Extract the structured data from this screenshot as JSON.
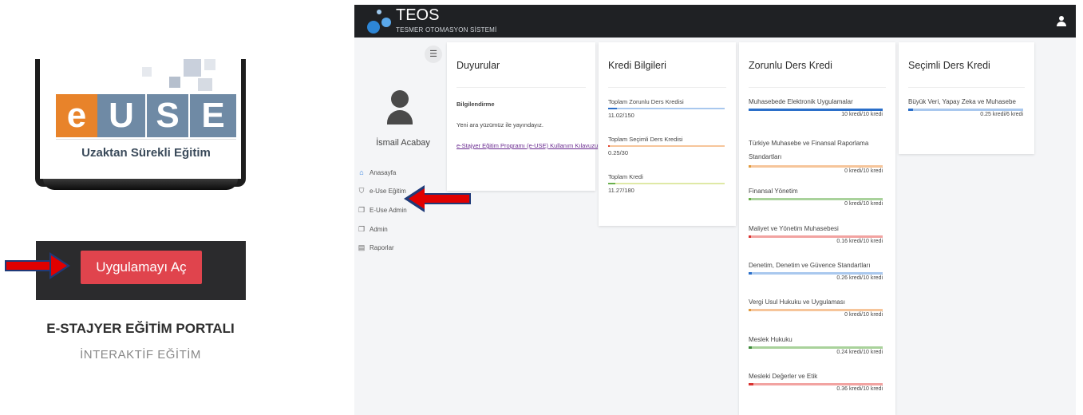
{
  "left_panel": {
    "logo_letters": [
      "e",
      "U",
      "S",
      "E"
    ],
    "logo_tagline": "Uzaktan Sürekli Eğitim",
    "open_app_button": "Uygulamayı Aç",
    "portal_title": "E-STAJYER EĞİTİM PORTALI",
    "portal_subtitle": "İNTERAKTİF EĞİTİM"
  },
  "app": {
    "brand_name": "TEOS",
    "brand_subtitle": "TESMER OTOMASYON SİSTEMİ",
    "sidebar_toggle_icon": "collapse-icon",
    "user_name": "İsmail Acabay",
    "nav": [
      {
        "label": "Anasayfa",
        "icon": "home-icon"
      },
      {
        "label": "e-Use Eğitim",
        "icon": "graduation-cap-icon"
      },
      {
        "label": "E-Use Admin",
        "icon": "copy-icon"
      },
      {
        "label": "Admin",
        "icon": "copy-icon"
      },
      {
        "label": "Raporlar",
        "icon": "file-icon"
      }
    ],
    "duyurular": {
      "title": "Duyurular",
      "heading": "Bilgilendirme",
      "text": "Yeni ara yüzümüz ile yayındayız.",
      "link": "e-Stajyer Eğitim Programı (e-USE) Kullanım Kılavuzu"
    },
    "kredi_bilgileri": {
      "title": "Kredi Bilgileri",
      "items": [
        {
          "label": "Toplam Zorunlu Ders Kredisi",
          "value": "11.02/150",
          "progress": 0.073,
          "color": "#2b6fc9",
          "track": "#a9c8ee"
        },
        {
          "label": "Toplam Seçimli Ders Kredisi",
          "value": "0.25/30",
          "progress": 0.008,
          "color": "#e0442e",
          "track": "#f6c59a"
        },
        {
          "label": "Toplam Kredi",
          "value": "11.27/180",
          "progress": 0.063,
          "color": "#6ab04c",
          "track": "#dfe9a6"
        }
      ]
    },
    "zorunlu": {
      "title": "Zorunlu Ders Kredi",
      "items": [
        {
          "label": "Muhasebede Elektronik Uygulamalar",
          "value": "10 kredi/10 kredi",
          "progress": 1.0,
          "color": "#2b6fc9",
          "track": "#a9c8ee"
        },
        {
          "label": "Türkiye Muhasebe ve Finansal Raporlama Standartları",
          "value": "0 kredi/10 kredi",
          "progress": 0.0,
          "color": "#e09a3e",
          "track": "#f6c59a"
        },
        {
          "label": "Finansal Yönetim",
          "value": "0 kredi/10 kredi",
          "progress": 0.0,
          "color": "#6ab04c",
          "track": "#a9d29b"
        },
        {
          "label": "Maliyet ve Yönetim Muhasebesi",
          "value": "0.16 kredi/10 kredi",
          "progress": 0.016,
          "color": "#d9322f",
          "track": "#f2a3a1"
        },
        {
          "label": "Denetim, Denetim ve Güvence Standartları",
          "value": "0.26 kredi/10 kredi",
          "progress": 0.026,
          "color": "#2b6fc9",
          "track": "#a9c8ee"
        },
        {
          "label": "Vergi Usul Hukuku ve Uygulaması",
          "value": "0 kredi/10 kredi",
          "progress": 0.0,
          "color": "#e09a3e",
          "track": "#f6c59a"
        },
        {
          "label": "Meslek Hukuku",
          "value": "0.24 kredi/10 kredi",
          "progress": 0.024,
          "color": "#3d8a3a",
          "track": "#a9d29b"
        },
        {
          "label": "Mesleki Değerler ve Etik",
          "value": "0.36 kredi/10 kredi",
          "progress": 0.036,
          "color": "#d9322f",
          "track": "#f2a3a1"
        }
      ]
    },
    "secimli": {
      "title": "Seçimli Ders Kredi",
      "items": [
        {
          "label": "Büyük Veri, Yapay Zeka ve Muhasebe",
          "value": "0.25 kredi/6 kredi",
          "progress": 0.042,
          "color": "#2b6fc9",
          "track": "#a9c8ee"
        }
      ]
    }
  }
}
